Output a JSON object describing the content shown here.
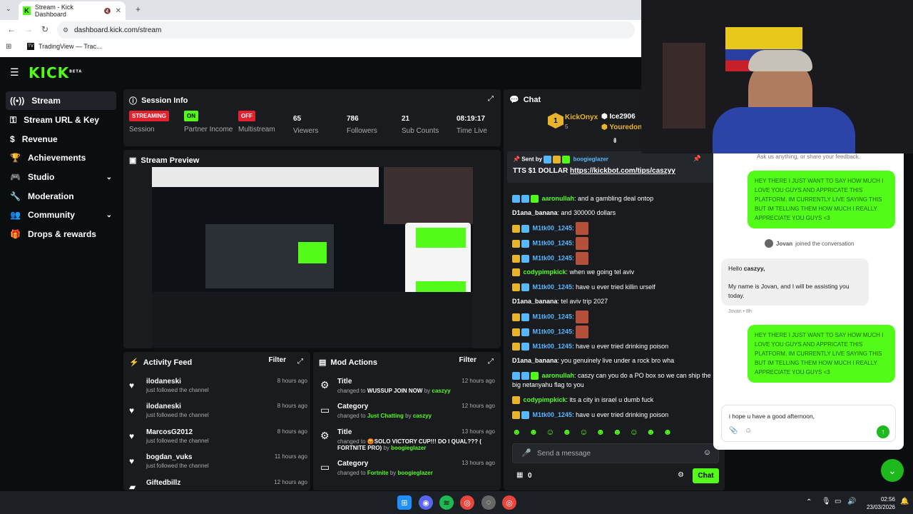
{
  "browser": {
    "tab_title": "Stream - Kick Dashboard",
    "url": "dashboard.kick.com/stream",
    "bookmark": "TradingView — Trac..."
  },
  "brand": {
    "logo": "KICK",
    "logo_sup": "BETA",
    "accent": "#53fc18"
  },
  "sidebar": {
    "items": [
      {
        "label": "Stream",
        "icon": "broadcast-icon"
      },
      {
        "label": "Stream URL & Key",
        "icon": "key-icon"
      },
      {
        "label": "Revenue",
        "icon": "dollar-icon"
      },
      {
        "label": "Achievements",
        "icon": "trophy-icon"
      },
      {
        "label": "Studio",
        "icon": "controller-icon"
      },
      {
        "label": "Moderation",
        "icon": "wrench-icon"
      },
      {
        "label": "Community",
        "icon": "users-icon"
      },
      {
        "label": "Drops & rewards",
        "icon": "gift-icon"
      }
    ]
  },
  "session": {
    "title": "Session Info",
    "streaming_badge": "STREAMING",
    "session_label": "Session",
    "partner_badge": "ON",
    "partner_label": "Partner Income",
    "multistream_badge": "OFF",
    "multistream_label": "Multistream",
    "viewers": "65",
    "viewers_label": "Viewers",
    "followers": "786",
    "followers_label": "Followers",
    "subs": "21",
    "subs_label": "Sub Counts",
    "time": "08:19:17",
    "time_label": "Time Live"
  },
  "preview": {
    "title": "Stream Preview"
  },
  "activity": {
    "title": "Activity Feed",
    "filter": "Filter",
    "items": [
      {
        "name": "ilodaneski",
        "sub": "just followed the channel",
        "time": "8 hours ago"
      },
      {
        "name": "ilodaneski",
        "sub": "just followed the channel",
        "time": "8 hours ago"
      },
      {
        "name": "MarcosG2012",
        "sub": "just followed the channel",
        "time": "8 hours ago"
      },
      {
        "name": "bogdan_vuks",
        "sub": "just followed the channel",
        "time": "11 hours ago"
      },
      {
        "name": "Giftedbillz",
        "sub": "",
        "time": "12 hours ago"
      }
    ]
  },
  "mod": {
    "title": "Mod Actions",
    "filter": "Filter",
    "items": [
      {
        "title": "Title",
        "prefix": "changed to",
        "value": "WUSSUP JOIN NOW",
        "by": "by",
        "user": "caszyy",
        "time": "12 hours ago"
      },
      {
        "title": "Category",
        "prefix": "changed to",
        "value": "Just Chatting",
        "by": "by",
        "user": "caszyy",
        "time": "12 hours ago"
      },
      {
        "title": "Title",
        "prefix": "changed to",
        "value": "😡SOLO VICTORY CUP!!! DO I QUAL??? ( FORTNITE PRO)",
        "by": "by",
        "user": "boogieglazer",
        "time": "13 hours ago"
      },
      {
        "title": "Category",
        "prefix": "changed to",
        "value": "Fortnite",
        "by": "by",
        "user": "boogieglazer",
        "time": "13 hours ago"
      }
    ]
  },
  "chat": {
    "title": "Chat",
    "top_gifter": "KickOnyx",
    "top_gifter_count": "5",
    "gifter2": "Ice2906",
    "gifter3": "Youredon",
    "pinned_by": "Sent by",
    "pinned_user": "boogieglazer",
    "pinned_text": "TTS $1 DOLLAR",
    "pinned_link": "https://kickbot.com/tips/caszyy",
    "messages": [
      {
        "user": "aaronullah",
        "color": "green",
        "text": "and a gambling deal ontop"
      },
      {
        "user": "D1ana_banana",
        "color": "white",
        "text": "and 300000 dollars"
      },
      {
        "user": "M1tk00_1245",
        "color": "blue",
        "text": "",
        "emote": true
      },
      {
        "user": "M1tk00_1245",
        "color": "blue",
        "text": "",
        "emote": true
      },
      {
        "user": "M1tk00_1245",
        "color": "blue",
        "text": "",
        "emote": true
      },
      {
        "user": "codypimpkick",
        "color": "green",
        "text": "when we going tel aviv"
      },
      {
        "user": "M1tk00_1245",
        "color": "blue",
        "text": "have u ever tried killin urself"
      },
      {
        "user": "D1ana_banana",
        "color": "white",
        "text": "tel aviv trip 2027"
      },
      {
        "user": "M1tk00_1245",
        "color": "blue",
        "text": "",
        "emote": true
      },
      {
        "user": "M1tk00_1245",
        "color": "blue",
        "text": "",
        "emote": true
      },
      {
        "user": "M1tk00_1245",
        "color": "blue",
        "text": "have u ever tried drinking poison"
      },
      {
        "user": "D1ana_banana",
        "color": "white",
        "text": "you genuinely live under a rock bro wha"
      },
      {
        "user": "aaronullah",
        "color": "green",
        "text": "caszy can you do a PO box so we can ship the big netanyahu flag to you"
      },
      {
        "user": "codypimpkick",
        "color": "green",
        "text": "its a city in israel u dumb fuck"
      },
      {
        "user": "M1tk00_1245",
        "color": "blue",
        "text": "have u ever tried drinking poison"
      }
    ],
    "input_placeholder": "Send a message",
    "points": "0",
    "send_label": "Chat"
  },
  "support": {
    "hint": "Ask us anything, or share your feedback.",
    "user_msg": "HEY THERE I JUST WANT TO SAY HOW MUCH I LOVE YOU GUYS AND APPRICATE THIS PLATFORM. IM CURRENTLY LIVE SAYING THIS BUT IM TELLING THEM HOW MUCH I REALLY APPRECIATE YOU GUYS <3",
    "joined_name": "Jovan",
    "joined_text": "joined the conversation",
    "agent_hello": "Hello",
    "agent_name": "caszyy,",
    "agent_body": "My name is Jovan, and I will be assisting you today.",
    "agent_meta": "Jovan • 8h",
    "user_msg2": "HEY THERE I JUST WANT TO SAY HOW MUCH I LOVE YOU GUYS AND APPRICATE THIS PLATFORM. IM CURRENTLY LIVE SAYING THIS BUT IM TELLING THEM HOW MUCH I REALLY APPRECIATE YOU GUYS <3",
    "draft": "i hope u have a good afternoon,"
  },
  "taskbar": {
    "time": "02:56",
    "date": "23/03/2026"
  }
}
